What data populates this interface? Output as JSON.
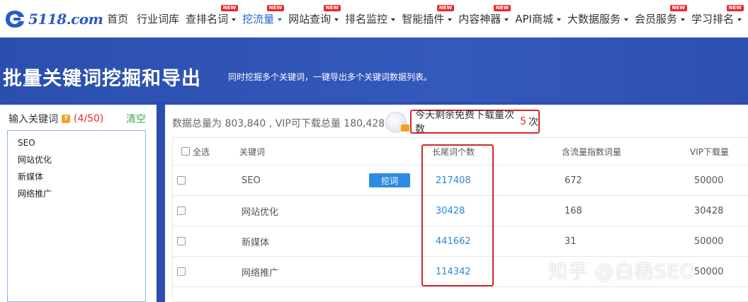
{
  "logo": {
    "text": "5118.com"
  },
  "nav": [
    {
      "label": "首页",
      "caret": false,
      "badge": ""
    },
    {
      "label": "行业词库",
      "caret": false,
      "badge": ""
    },
    {
      "label": "查排名词",
      "caret": true,
      "badge": "NEW"
    },
    {
      "label": "挖流量",
      "caret": true,
      "badge": "NEW",
      "active": true
    },
    {
      "label": "网站查询",
      "caret": true,
      "badge": "NEW"
    },
    {
      "label": "排名监控",
      "caret": true,
      "badge": ""
    },
    {
      "label": "智能插件",
      "caret": true,
      "badge": "NEW"
    },
    {
      "label": "内容神器",
      "caret": true,
      "badge": "NEW"
    },
    {
      "label": "API商城",
      "caret": true,
      "badge": ""
    },
    {
      "label": "大数据服务",
      "caret": true,
      "badge": ""
    },
    {
      "label": "会员服务",
      "caret": true,
      "badge": "NEW"
    },
    {
      "label": "学习排名",
      "caret": true,
      "badge": "NEW"
    }
  ],
  "hero": {
    "title": "批量关键词挖掘和导出",
    "subtitle": "同时挖掘多个关键词，一键导出多个关键词数据列表。"
  },
  "left_panel": {
    "title": "输入关键词",
    "help_icon": "?",
    "count": "(4/50)",
    "clear_label": "清空",
    "keywords": [
      "SEO",
      "网站优化",
      "新媒体",
      "网络推广"
    ]
  },
  "main": {
    "stats": "数据总量为 803,840 , VIP可下载总量 180,428",
    "quota_label": "今天剩余免费下载量次数",
    "quota_value": "5",
    "quota_unit": "次",
    "table": {
      "headers": {
        "select_all": "全选",
        "keyword": "关键词",
        "longtail": "长尾词个数",
        "traffic": "含流量指数词量",
        "vip": "VIP下载量"
      },
      "rows": [
        {
          "keyword": "SEO",
          "action": "挖词",
          "longtail": "217408",
          "traffic": "672",
          "vip": "50000"
        },
        {
          "keyword": "网站优化",
          "action": "",
          "longtail": "30428",
          "traffic": "168",
          "vip": "30428"
        },
        {
          "keyword": "新媒体",
          "action": "",
          "longtail": "441662",
          "traffic": "31",
          "vip": "50000"
        },
        {
          "keyword": "网络推广",
          "action": "",
          "longtail": "114342",
          "traffic": "",
          "vip": "50000"
        }
      ]
    }
  },
  "watermark": "知乎 @白杨SEO",
  "colors": {
    "brand_blue": "#2a59c9",
    "nav_active": "#2361d6",
    "hero_bg": "#2c4eb0",
    "badge_red": "#e8282b",
    "clear_green": "#42a84a",
    "link_blue": "#2b87d6",
    "button_blue": "#2e8be0",
    "highlight_red": "#d7262d"
  }
}
